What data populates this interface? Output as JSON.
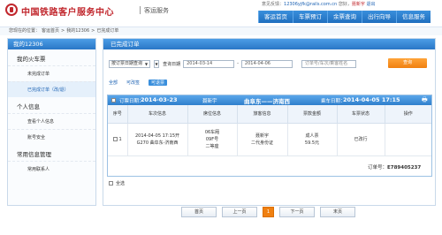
{
  "header": {
    "logo_text": "中国铁路客户服务中心",
    "service_text": "客运服务",
    "feedback_label": "意见反馈：",
    "feedback_email": "12306yjfk@rails.com.cn",
    "greeting": "您好，",
    "user_name": "聂新宇",
    "logout": "退出"
  },
  "nav": {
    "items": [
      "客运首页",
      "车票预订",
      "余票查询",
      "出行向导",
      "信息服务"
    ]
  },
  "breadcrumb": {
    "prefix": "您现在的位置：",
    "items": [
      "客运首页",
      ">",
      "我的12306",
      ">",
      "已完成订单"
    ]
  },
  "sidebar": {
    "header": "我的12306",
    "groups": [
      {
        "title": "我的火车票",
        "items": [
          "未完成订单",
          "已完成订单（改/退）"
        ]
      },
      {
        "title": "个人信息",
        "items": [
          "查看个人信息",
          "账号安全"
        ]
      },
      {
        "title": "常用信息管理",
        "items": [
          "常用联系人"
        ]
      }
    ]
  },
  "panel": {
    "title": "已完成订单",
    "filter": {
      "date_type": "按订票日期查询",
      "date_label": "查询日期",
      "date_from": "2014-03-14",
      "date_to": "2014-04-06",
      "keyword_placeholder": "订单号/车次/乘客姓名",
      "query_button": "查询"
    },
    "tabs": [
      "全部",
      "可改签",
      "可退票"
    ],
    "order": {
      "book_date_label": "订票日期：",
      "book_date": "2014-03-23",
      "passenger": "聂新宇",
      "route": "曲阜东——济南西",
      "ride_date_label": "乘车日期：",
      "ride_date": "2014-04-05 17:15",
      "columns": [
        "序号",
        "车次信息",
        "席位信息",
        "旅客信息",
        "票款金额",
        "车票状态",
        "操作"
      ],
      "rows": [
        {
          "index": "1",
          "train_line1": "2014-04-05 17:15开",
          "train_line2": "G270 曲阜东-济南西",
          "seat_line1": "06车厢",
          "seat_line2": "09F号",
          "seat_line3": "二等座",
          "pax_line1": "聂新宇",
          "pax_line2": "二代身份证",
          "price_line1": "成人票",
          "price_line2": "59.5元",
          "status": "已改行",
          "action": ""
        }
      ],
      "order_no_label": "订单号：",
      "order_no": "E789405237"
    },
    "select_all": "全选"
  },
  "pager": {
    "first": "首页",
    "prev": "上一页",
    "current": "1",
    "next": "下一页",
    "last": "末页"
  }
}
